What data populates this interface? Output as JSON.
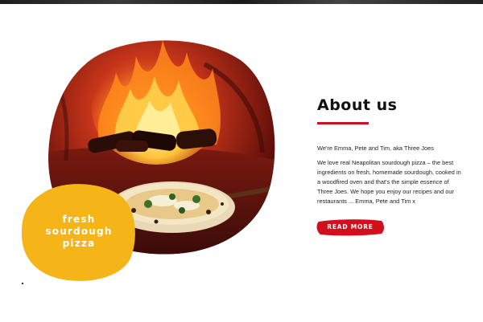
{
  "badge": {
    "lines": [
      "fresh",
      "sourdough",
      "pizza"
    ]
  },
  "about": {
    "title": "About us",
    "intro": "We're Emma, Pete and Tim, aka Three Joes",
    "body": "We love real Neapolitan sourdough pizza – the best ingredients on fresh, homemade sourdough, cooked in a woodfired oven and that's the simple essence of Three Joes. We hope you enjoy our recipes and our restaurants ... Emma, Pete and Tim x",
    "cta_label": "READ MORE"
  },
  "colors": {
    "accent_red": "#d0101c",
    "badge_yellow": "#f5b418",
    "text": "#222222"
  },
  "icons": {
    "photo": "pizza-oven-photo",
    "badge_shape": "yellow-blob"
  }
}
